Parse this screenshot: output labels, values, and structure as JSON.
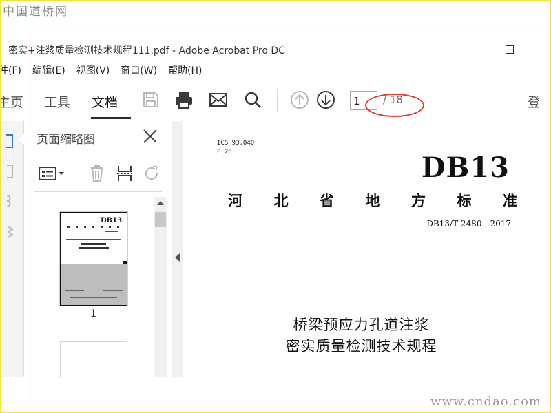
{
  "watermarks": {
    "top": "中国道桥网",
    "bottom": "www.cndao.com"
  },
  "window": {
    "title": "密实+注浆质量检测技术规程111.pdf - Adobe Acrobat Pro DC"
  },
  "menu": [
    "件(F)",
    "编辑(E)",
    "视图(V)",
    "窗口(W)",
    "帮助(H)"
  ],
  "toolbar": {
    "tabs": [
      "主页",
      "工具",
      "文档"
    ],
    "tabs_display": [
      "主页",
      "工具",
      "文档"
    ],
    "active_tab": "文档",
    "current_page": "1",
    "page_total": "/ 18",
    "cut_label": "登",
    "highlight_color": "#e43a2f"
  },
  "panel": {
    "title": "页面缩略图",
    "thumbnail_page_label": "1"
  },
  "document": {
    "ics": "ICS 93.040",
    "p": "P 28",
    "code": "DB13",
    "standard_chars": [
      "河",
      "北",
      "省",
      "地",
      "方",
      "标",
      "准"
    ],
    "standard_number": "DB13/T 2480—2017",
    "title_line1": "桥梁预应力孔道注浆",
    "title_line2": "密实质量检测技术规程"
  },
  "thumbnail": {
    "code": "DB13",
    "title_line1": "桥梁预应力孔道注浆",
    "title_line2": "密实质量检测技术规程"
  }
}
